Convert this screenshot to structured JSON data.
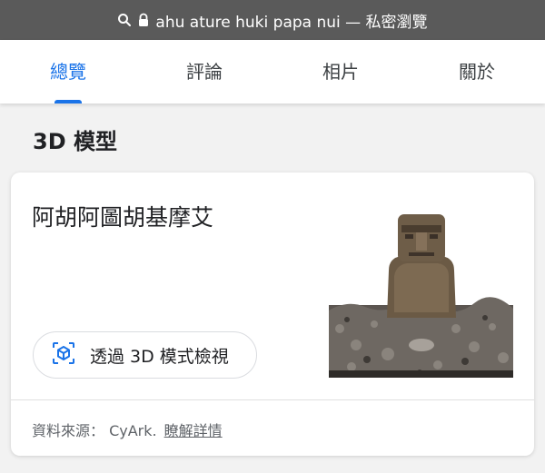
{
  "address_bar": {
    "url_text": "ahu ature huki papa nui — 私密瀏覽",
    "icons": [
      "search-icon",
      "lock-icon"
    ]
  },
  "tabs": [
    {
      "label": "總覽",
      "active": true
    },
    {
      "label": "評論",
      "active": false
    },
    {
      "label": "相片",
      "active": false
    },
    {
      "label": "關於",
      "active": false
    }
  ],
  "section": {
    "title": "3D 模型"
  },
  "card": {
    "title": "阿胡阿圖胡基摩艾",
    "image_icon": "moai-statue-image",
    "view_button_label": "透過 3D 模式檢視",
    "view_button_icon": "3d-cube-icon",
    "source_label": "資料來源： CyArk.",
    "learn_more_link": "瞭解詳情"
  },
  "colors": {
    "accent": "#1a73e8",
    "topbar_bg": "#5a5a5a",
    "page_bg": "#f2f2f2"
  }
}
